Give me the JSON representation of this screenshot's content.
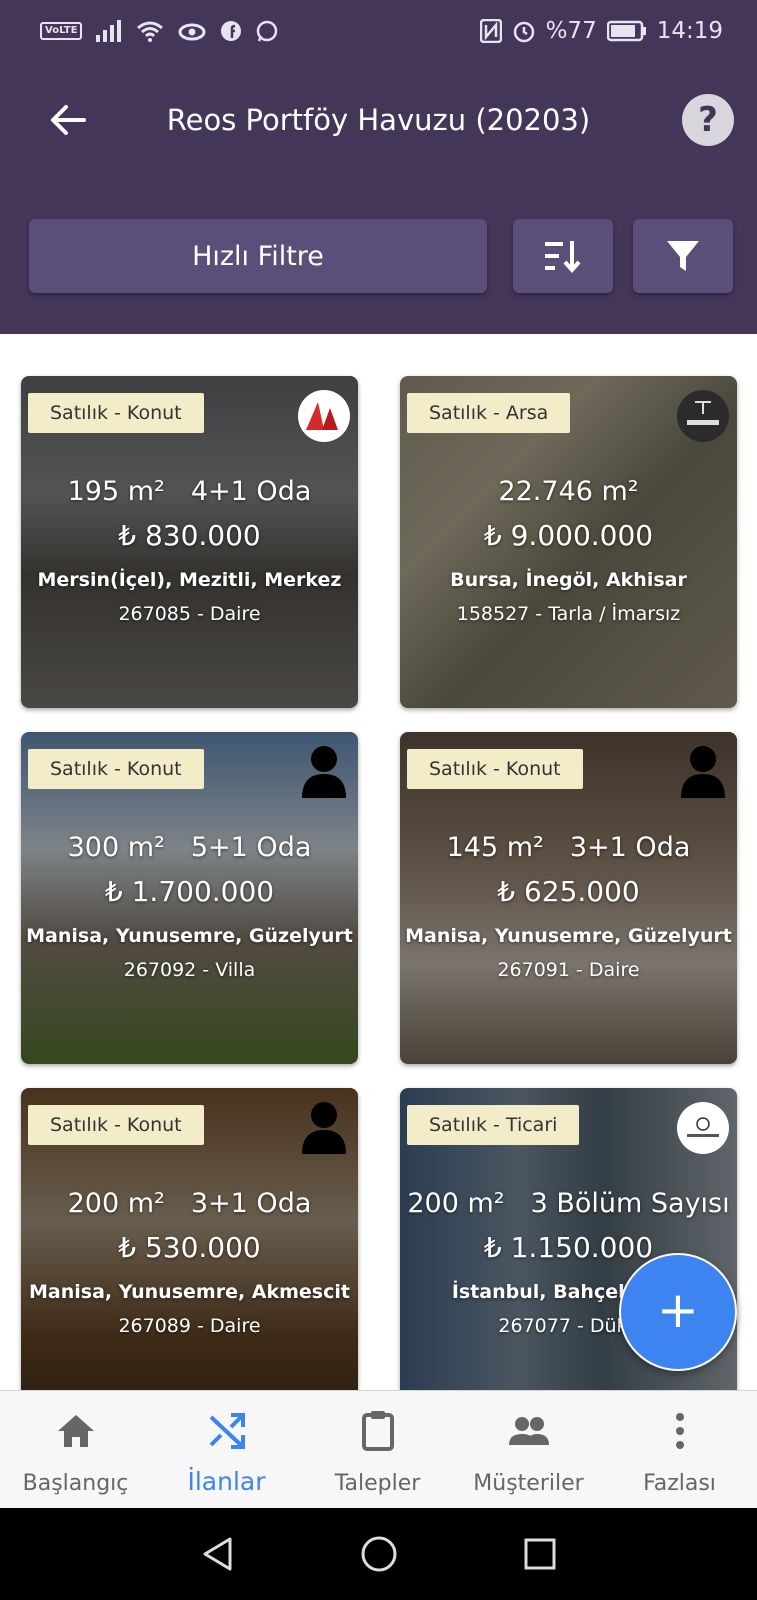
{
  "status_bar": {
    "volte": "VoLTE",
    "battery": "%77",
    "time": "14:19"
  },
  "header": {
    "title": "Reos Portföy Havuzu (20203)",
    "help_icon": "question-circle-icon",
    "quick_filter_label": "Hızlı Filtre",
    "sort_icon": "sort-icon",
    "filter_icon": "filter-icon"
  },
  "listings": [
    {
      "badge": "Satılık - Konut",
      "area": "195 m²",
      "rooms": "4+1 Oda",
      "price": "₺ 830.000",
      "location": "Mersin(İçel), Mezitli, Merkez",
      "ref": "267085 - Daire",
      "owner": "realty-world-logo"
    },
    {
      "badge": "Satılık - Arsa",
      "area": "22.746 m²",
      "rooms": "",
      "price": "₺ 9.000.000",
      "location": "Bursa, İnegöl, Akhisar",
      "ref": "158527 - Tarla / İmarsız",
      "owner": "senollar-logo"
    },
    {
      "badge": "Satılık - Konut",
      "area": "300 m²",
      "rooms": "5+1 Oda",
      "price": "₺ 1.700.000",
      "location": "Manisa, Yunusemre, Güzelyurt",
      "ref": "267092 - Villa",
      "owner": "person-icon"
    },
    {
      "badge": "Satılık - Konut",
      "area": "145 m²",
      "rooms": "3+1 Oda",
      "price": "₺ 625.000",
      "location": "Manisa, Yunusemre, Güzelyurt",
      "ref": "267091 - Daire",
      "owner": "person-icon"
    },
    {
      "badge": "Satılık - Konut",
      "area": "200 m²",
      "rooms": "3+1 Oda",
      "price": "₺ 530.000",
      "location": "Manisa, Yunusemre, Akmescit",
      "ref": "267089 - Daire",
      "owner": "person-icon"
    },
    {
      "badge": "Satılık - Ticari",
      "area": "200 m²",
      "rooms": "3 Bölüm Sayısı",
      "price": "₺ 1.150.000",
      "location": "İstanbul, Bahçelievler",
      "ref": "267077 - Dükk",
      "owner": "agency-round-logo"
    }
  ],
  "fab": {
    "label": "+"
  },
  "bottom_nav": [
    {
      "label": "Başlangıç",
      "icon": "home-icon"
    },
    {
      "label": "İlanlar",
      "icon": "shuffle-icon",
      "active": true
    },
    {
      "label": "Talepler",
      "icon": "clipboard-icon"
    },
    {
      "label": "Müşteriler",
      "icon": "people-icon"
    },
    {
      "label": "Fazlası",
      "icon": "more-vert-icon"
    }
  ],
  "colors": {
    "header_bg": "#433659",
    "button_bg": "#5b4f79",
    "badge_bg": "#f3ecc9",
    "accent": "#3d84f1"
  }
}
